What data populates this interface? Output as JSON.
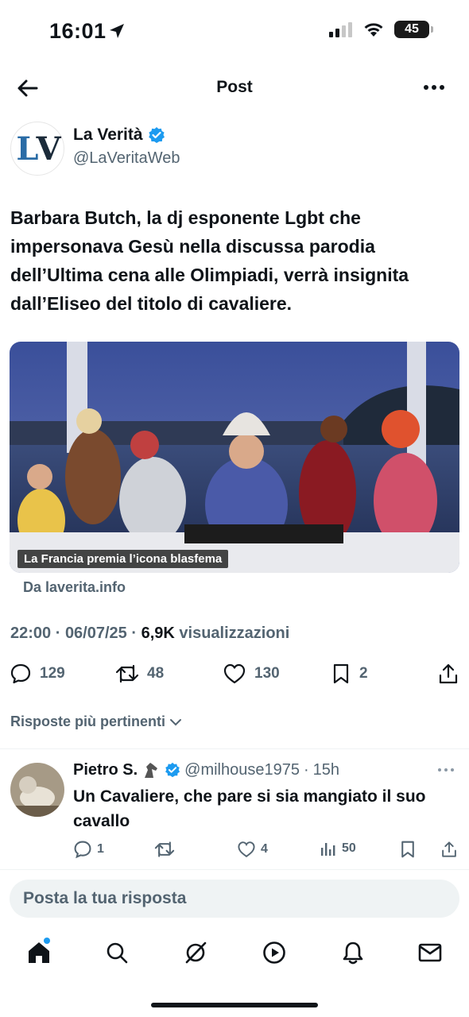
{
  "status_bar": {
    "time": "16:01",
    "battery": "45"
  },
  "header": {
    "title": "Post"
  },
  "author": {
    "name": "La Verità",
    "handle": "@LaVeritaWeb",
    "avatar_letters": [
      "L",
      "V"
    ]
  },
  "tweet": {
    "text": "Barbara Butch, la dj esponente Lgbt che impersonava Gesù nella discussa parodia dell’Ultima cena alle Olimpiadi, verrà insignita dall’Eliseo del titolo di cavaliere.",
    "media_caption": "La Francia premia l’icona blasfema",
    "source": "Da laverita.info",
    "meta": {
      "time": "22:00",
      "date": "06/07/25",
      "views": "6,9K",
      "views_label": "visualizzazioni"
    }
  },
  "actions": {
    "replies": "129",
    "reposts": "48",
    "likes": "130",
    "bookmarks": "2"
  },
  "replies_filter": "Risposte più pertinenti",
  "reply": {
    "name": "Pietro S.",
    "handle": "@milhouse1975",
    "age": "15h",
    "text": "Un Cavaliere, che pare si sia mangiato il suo cavallo",
    "replies": "1",
    "likes": "4",
    "views": "50"
  },
  "compose": {
    "placeholder": "Posta la tua risposta"
  },
  "tabbar": [
    "home-icon",
    "search-icon",
    "grok-icon",
    "video-icon",
    "notifications-icon",
    "messages-icon"
  ],
  "colors": {
    "accent": "#1d9bf0",
    "text": "#0f1419",
    "secondary": "#536471"
  }
}
